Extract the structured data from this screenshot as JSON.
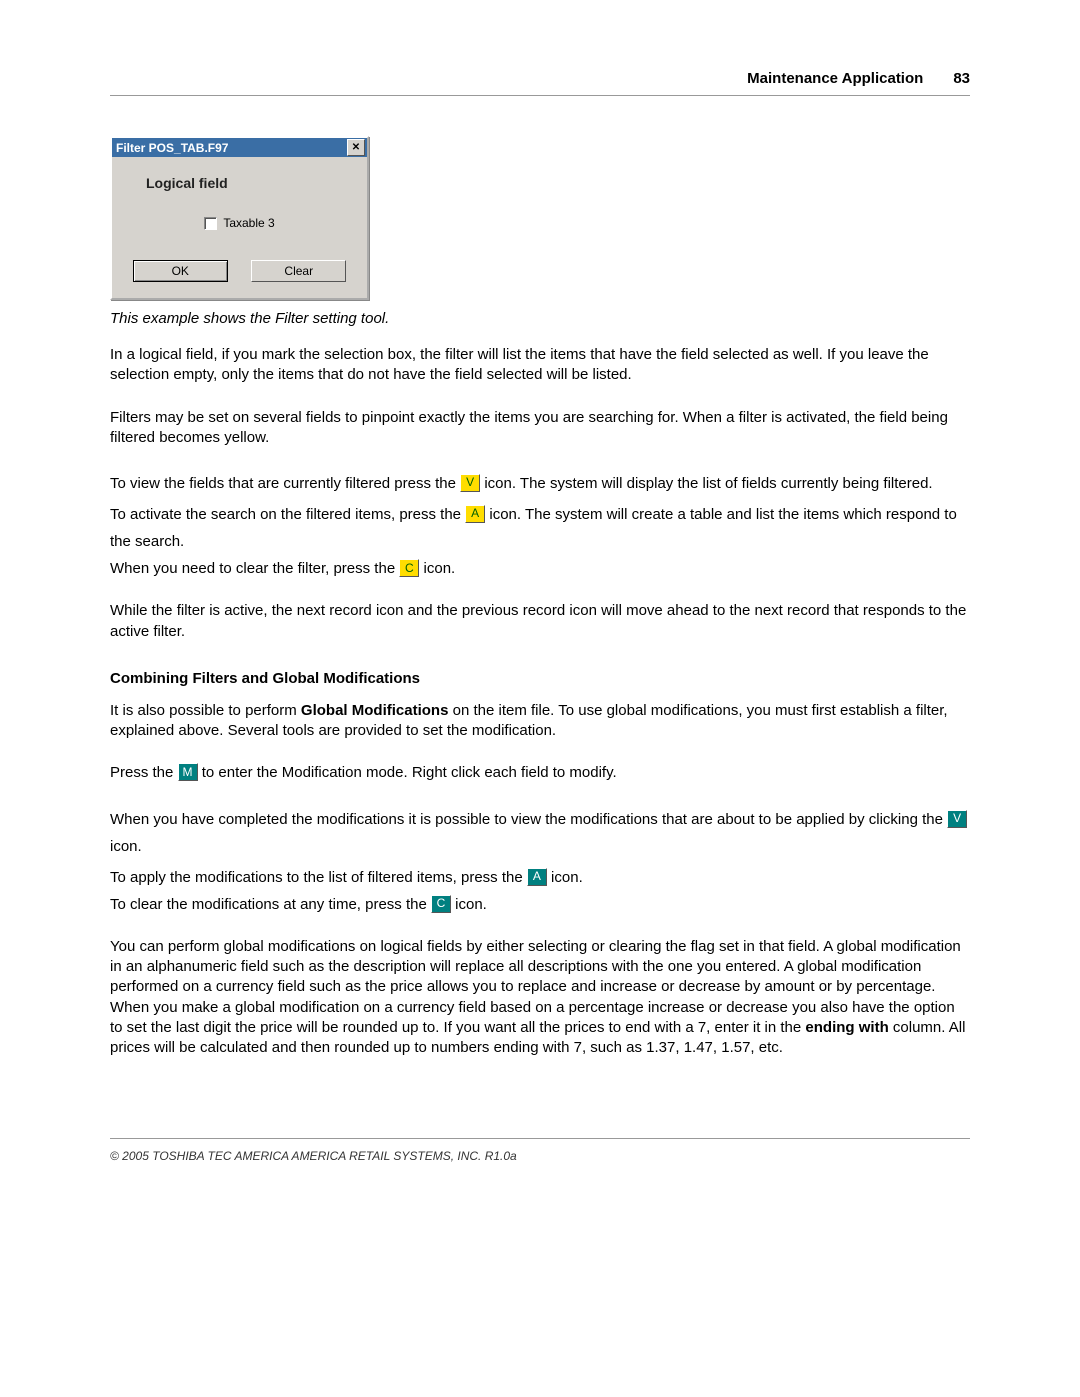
{
  "header": {
    "title": "Maintenance Application",
    "page_number": "83"
  },
  "dialog": {
    "title": "Filter POS_TAB.F97",
    "close_glyph": "✕",
    "section_label": "Logical field",
    "checkbox_label": "Taxable 3",
    "ok_label": "OK",
    "clear_label": "Clear"
  },
  "caption": "This example shows the Filter setting tool.",
  "body": {
    "p1": " In a logical field, if you mark the selection box, the filter will list the items that have the field selected as well. If you leave the selection empty, only the items that do not have the field selected will be listed.",
    "p2": " Filters may be set on several fields to pinpoint exactly the items you are searching for. When a filter is activated, the field being filtered becomes yellow.",
    "p3a": " To view the fields that are currently filtered press the ",
    "p3b": " icon. The system will display the list of fields currently being filtered.",
    "p4a": " To activate the search on the filtered items, press the ",
    "p4b": " icon. The system will create a table and list the items which respond to the search.",
    "p5a": " When you need to clear the filter, press the ",
    "p5b": " icon.",
    "p6": " While the filter is active, the next record icon and the previous record icon will move ahead to the next record that responds to the active filter.",
    "heading2": "Combining Filters and Global Modifications",
    "p7a": " It is also possible to perform ",
    "p7bold": "Global Modifications",
    "p7b": "   on the item file. To use global modifications, you must first establish a filter, explained above. Several tools are provided to set the modification.",
    "p8a": " Press the ",
    "p8b": " to enter the Modification mode. Right click each field to modify.",
    "p9a": " When you have completed the modifications it is possible to view the modifications that are about to be applied by clicking the ",
    "p9b": " icon.",
    "p10a": " To apply the modifications to the list of filtered items, press the ",
    "p10b": " icon.",
    "p11a": " To clear the modifications at any time, press the ",
    "p11b": " icon.",
    "p12a": " You can perform global modifications on logical fields by either selecting or clearing the flag set in that field. A global modification in an alphanumeric field such as the description will replace all descriptions with the one you entered. A global modification performed on a currency field such as the price allows you to replace and increase or decrease by amount or by percentage. When you make a global modification on a currency field based on a percentage increase or decrease you also have the option to set the last digit the price will be rounded up to. If you want all the prices to end with a 7, enter it in the ",
    "p12bold": "ending with",
    "p12b": "   column. All prices will be calculated and then rounded up to numbers ending with 7, such as 1.37, 1.47, 1.57, etc."
  },
  "icons": {
    "v": "V",
    "a": "A",
    "c": "C",
    "m": "M"
  },
  "footer": "© 2005 TOSHIBA TEC AMERICA AMERICA RETAIL SYSTEMS, INC.   R1.0a"
}
